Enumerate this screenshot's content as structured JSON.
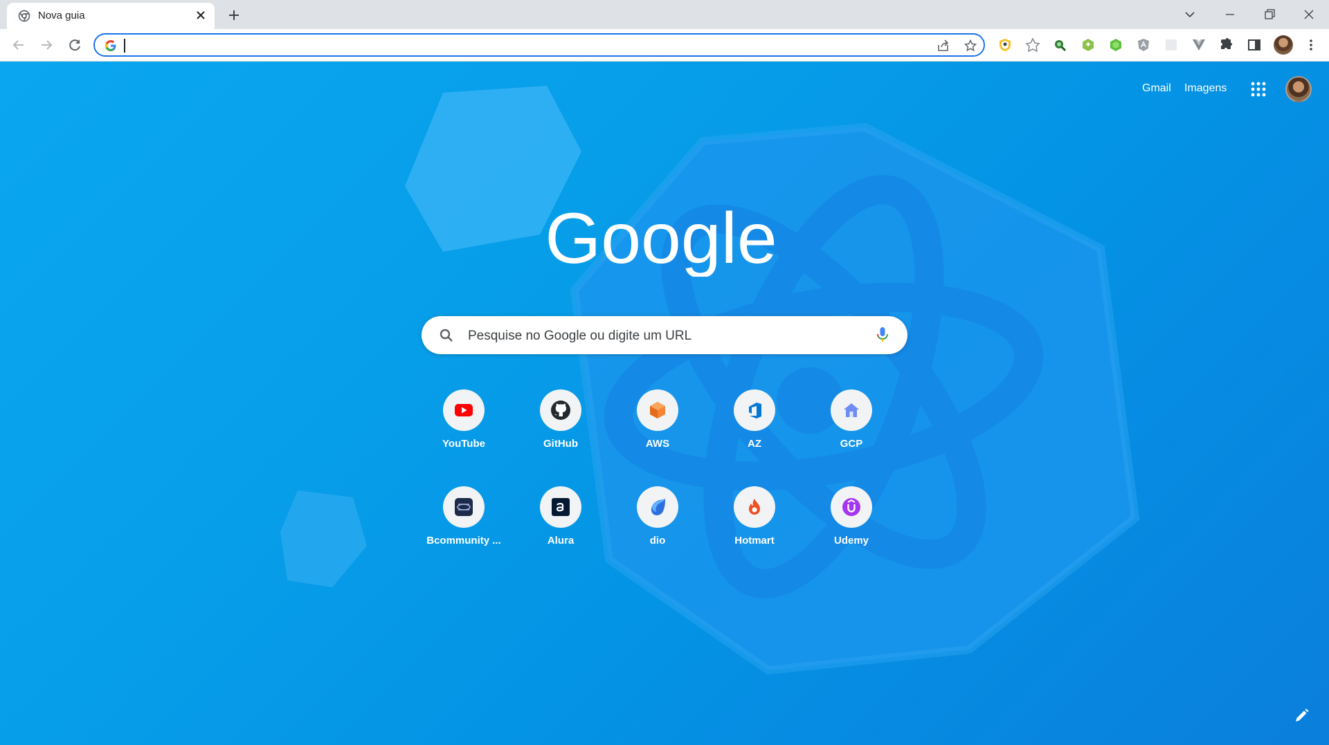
{
  "browser": {
    "tab": {
      "title": "Nova guia"
    },
    "omnibox": {
      "value": "",
      "placeholder": ""
    }
  },
  "ntp": {
    "top_links": {
      "gmail": "Gmail",
      "images": "Imagens"
    },
    "search": {
      "placeholder": "Pesquise no Google ou digite um URL"
    },
    "logo_text": "Google",
    "shortcuts": [
      {
        "label": "YouTube",
        "icon": "youtube-icon"
      },
      {
        "label": "GitHub",
        "icon": "github-icon"
      },
      {
        "label": "AWS",
        "icon": "aws-icon"
      },
      {
        "label": "AZ",
        "icon": "azure-devops-icon"
      },
      {
        "label": "GCP",
        "icon": "home-icon"
      },
      {
        "label": "Bcommunity ...",
        "icon": "bcommunity-icon"
      },
      {
        "label": "Alura",
        "icon": "alura-icon"
      },
      {
        "label": "dio",
        "icon": "dio-icon"
      },
      {
        "label": "Hotmart",
        "icon": "hotmart-icon"
      },
      {
        "label": "Udemy",
        "icon": "udemy-icon"
      }
    ]
  },
  "colors": {
    "accent": "#1a73e8",
    "background_top": "#0aa6f0",
    "background_bottom": "#0a7fdc"
  }
}
